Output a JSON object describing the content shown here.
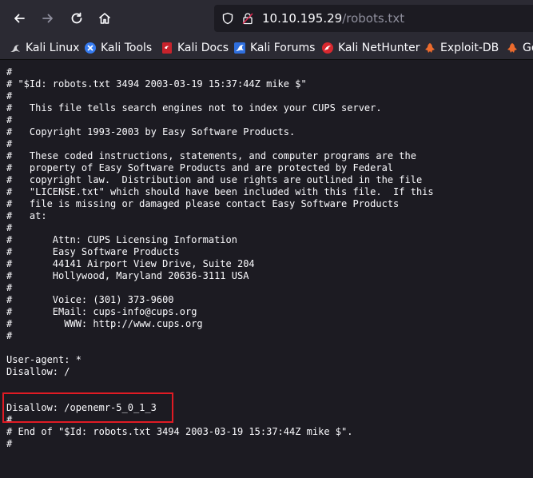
{
  "browser": {
    "url_host": "10.10.195.29",
    "url_path": "/robots.txt",
    "icons": {
      "back": "arrow-left-icon",
      "forward": "arrow-right-icon",
      "reload": "reload-icon",
      "home": "home-icon",
      "security": "shield-icon",
      "site": "site-info-icon"
    }
  },
  "bookmarks": [
    {
      "label": "Kali Linux",
      "icon": "kali-dragon-icon"
    },
    {
      "label": "Kali Tools",
      "icon": "kali-tools-icon"
    },
    {
      "label": "Kali Docs",
      "icon": "kali-docs-icon"
    },
    {
      "label": "Kali Forums",
      "icon": "kali-forums-icon"
    },
    {
      "label": "Kali NetHunter",
      "icon": "kali-nethunter-icon"
    },
    {
      "label": "Exploit-DB",
      "icon": "exploit-db-icon"
    },
    {
      "label": "Go",
      "icon": "google-hacking-db-icon"
    }
  ],
  "colors": {
    "toolbar_bg": "#2b2a33",
    "page_bg": "#1c1b22",
    "text": "#fbfbfe",
    "highlight_border": "#e01b24"
  },
  "file_content": "#\n# \"$Id: robots.txt 3494 2003-03-19 15:37:44Z mike $\"\n#\n#   This file tells search engines not to index your CUPS server.\n#\n#   Copyright 1993-2003 by Easy Software Products.\n#\n#   These coded instructions, statements, and computer programs are the\n#   property of Easy Software Products and are protected by Federal\n#   copyright law.  Distribution and use rights are outlined in the file\n#   \"LICENSE.txt\" which should have been included with this file.  If this\n#   file is missing or damaged please contact Easy Software Products\n#   at:\n#\n#       Attn: CUPS Licensing Information\n#       Easy Software Products\n#       44141 Airport View Drive, Suite 204\n#       Hollywood, Maryland 20636-3111 USA\n#\n#       Voice: (301) 373-9600\n#       EMail: cups-info@cups.org\n#         WWW: http://www.cups.org\n#\n\nUser-agent: *\nDisallow: /\n\n\nDisallow: /openemr-5_0_1_3\n#\n# End of \"$Id: robots.txt 3494 2003-03-19 15:37:44Z mike $\".\n#"
}
